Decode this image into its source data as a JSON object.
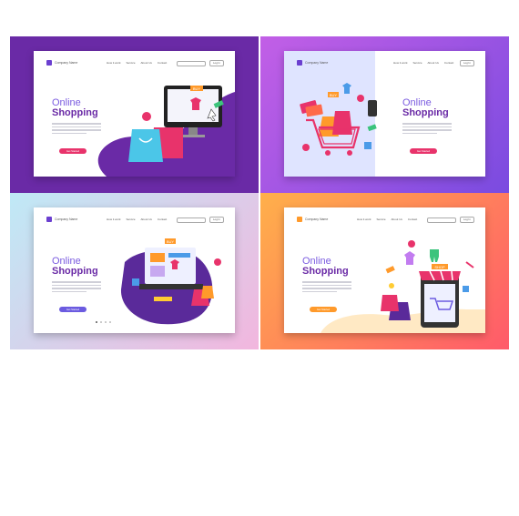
{
  "slides": [
    {
      "brand": "Company Name",
      "nav": [
        "How it work",
        "Service",
        "About Us",
        "Contact"
      ],
      "login": "Log In",
      "heading_line1": "Online",
      "heading_line2": "Shopping",
      "cta": "Get Started",
      "cta_color": "#e8336b",
      "badge": "BUY"
    },
    {
      "brand": "Company Name",
      "nav": [
        "How it work",
        "Service",
        "About Us",
        "Contact"
      ],
      "login": "Log In",
      "heading_line1": "Online",
      "heading_line2": "Shopping",
      "cta": "Get Started",
      "cta_color": "#e8336b",
      "badge": "BUY"
    },
    {
      "brand": "Company Name",
      "nav": [
        "How it work",
        "Service",
        "About Us",
        "Contact"
      ],
      "login": "Log In",
      "heading_line1": "Online",
      "heading_line2": "Shopping",
      "cta": "Get Started",
      "cta_color": "#6b5be0",
      "badge": "BUY"
    },
    {
      "brand": "Company Name",
      "nav": [
        "How it work",
        "Service",
        "About Us",
        "Contact"
      ],
      "login": "Log In",
      "heading_line1": "Online",
      "heading_line2": "Shopping",
      "cta": "Get Started",
      "cta_color": "#ff9a2b",
      "badge": "SHOP"
    }
  ],
  "colors": {
    "accent_purple": "#6a2aa6",
    "accent_pink": "#e8336b",
    "accent_orange": "#ff9a2b"
  }
}
